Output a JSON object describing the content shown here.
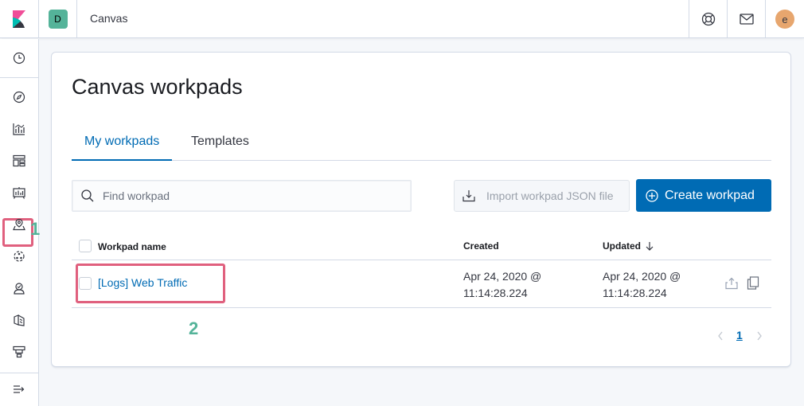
{
  "header": {
    "space_initial": "D",
    "app_title": "Canvas",
    "user_initial": "e"
  },
  "annotations": {
    "marker_1": "1",
    "marker_2": "2"
  },
  "sidenav": {
    "items": [
      {
        "icon": "clock-icon"
      },
      {
        "icon": "compass-icon"
      },
      {
        "icon": "chart-icon"
      },
      {
        "icon": "dashboard-icon"
      },
      {
        "icon": "canvas-icon",
        "highlighted": true
      },
      {
        "icon": "maps-icon"
      },
      {
        "icon": "ml-icon"
      },
      {
        "icon": "metrics-icon"
      },
      {
        "icon": "logs-icon"
      },
      {
        "icon": "uptime-icon"
      },
      {
        "icon": "collapse-icon"
      }
    ]
  },
  "main": {
    "title": "Canvas workpads",
    "tabs": [
      {
        "label": "My workpads",
        "selected": true
      },
      {
        "label": "Templates",
        "selected": false
      }
    ],
    "search": {
      "placeholder": "Find workpad",
      "value": ""
    },
    "import_label": "Import workpad JSON file",
    "create_label": "Create workpad",
    "table": {
      "columns": [
        "Workpad name",
        "Created",
        "Updated"
      ],
      "rows": [
        {
          "name": "[Logs] Web Traffic",
          "created_line1": "Apr 24, 2020 @",
          "created_line2": "11:14:28.224",
          "updated_line1": "Apr 24, 2020 @",
          "updated_line2": "11:14:28.224"
        }
      ]
    },
    "pagination": {
      "current_page": "1"
    }
  },
  "colors": {
    "accent": "#006bb4",
    "highlight": "#e0607e",
    "marker": "#54b399",
    "space_avatar": "#54b399",
    "user_avatar": "#e7a66e"
  }
}
